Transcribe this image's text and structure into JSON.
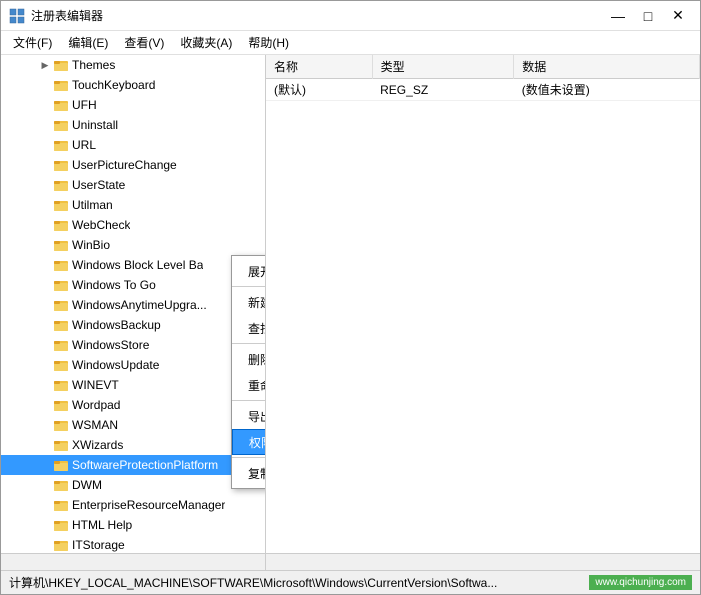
{
  "window": {
    "title": "注册表编辑器",
    "icon": "regedit"
  },
  "titlebar": {
    "controls": {
      "minimize": "—",
      "maximize": "□",
      "close": "✕"
    }
  },
  "menubar": {
    "items": [
      {
        "label": "文件(F)"
      },
      {
        "label": "编辑(E)"
      },
      {
        "label": "查看(V)"
      },
      {
        "label": "收藏夹(A)"
      },
      {
        "label": "帮助(H)"
      }
    ]
  },
  "tree": {
    "items": [
      {
        "label": "Themes",
        "indent": 2,
        "has_arrow": true,
        "level": 2
      },
      {
        "label": "TouchKeyboard",
        "indent": 2,
        "has_arrow": false,
        "level": 2
      },
      {
        "label": "UFH",
        "indent": 2,
        "has_arrow": false,
        "level": 2
      },
      {
        "label": "Uninstall",
        "indent": 2,
        "has_arrow": false,
        "level": 2
      },
      {
        "label": "URL",
        "indent": 2,
        "has_arrow": false,
        "level": 2
      },
      {
        "label": "UserPictureChange",
        "indent": 2,
        "has_arrow": false,
        "level": 2
      },
      {
        "label": "UserState",
        "indent": 2,
        "has_arrow": false,
        "level": 2
      },
      {
        "label": "Utilman",
        "indent": 2,
        "has_arrow": false,
        "level": 2
      },
      {
        "label": "WebCheck",
        "indent": 2,
        "has_arrow": false,
        "level": 2
      },
      {
        "label": "WinBio",
        "indent": 2,
        "has_arrow": false,
        "level": 2
      },
      {
        "label": "Windows Block Level Ba",
        "indent": 2,
        "has_arrow": false,
        "level": 2
      },
      {
        "label": "Windows To Go",
        "indent": 2,
        "has_arrow": false,
        "level": 2
      },
      {
        "label": "WindowsAnytimeUpgra...",
        "indent": 2,
        "has_arrow": false,
        "level": 2
      },
      {
        "label": "WindowsBackup",
        "indent": 2,
        "has_arrow": false,
        "level": 2
      },
      {
        "label": "WindowsStore",
        "indent": 2,
        "has_arrow": false,
        "level": 2
      },
      {
        "label": "WindowsUpdate",
        "indent": 2,
        "has_arrow": false,
        "level": 2
      },
      {
        "label": "WINEVT",
        "indent": 2,
        "has_arrow": false,
        "level": 2
      },
      {
        "label": "Wordpad",
        "indent": 2,
        "has_arrow": false,
        "level": 2
      },
      {
        "label": "WSMAN",
        "indent": 2,
        "has_arrow": false,
        "level": 2
      },
      {
        "label": "XWizards",
        "indent": 2,
        "has_arrow": false,
        "level": 2
      },
      {
        "label": "SoftwareProtectionPlatform",
        "indent": 2,
        "has_arrow": false,
        "level": 2,
        "selected": true
      },
      {
        "label": "DWM",
        "indent": 1,
        "has_arrow": false,
        "level": 1
      },
      {
        "label": "EnterpriseResourceManager",
        "indent": 1,
        "has_arrow": false,
        "level": 1
      },
      {
        "label": "HTML Help",
        "indent": 1,
        "has_arrow": false,
        "level": 1
      },
      {
        "label": "ITStorage",
        "indent": 1,
        "has_arrow": false,
        "level": 1
      }
    ]
  },
  "right_panel": {
    "columns": [
      "名称",
      "类型",
      "数据"
    ],
    "rows": [
      {
        "name": "(默认)",
        "type": "REG_SZ",
        "data": "(数值未设置)"
      }
    ]
  },
  "context_menu": {
    "items": [
      {
        "label": "展开",
        "type": "item"
      },
      {
        "type": "separator"
      },
      {
        "label": "新建(N)",
        "type": "item",
        "has_arrow": true
      },
      {
        "label": "查找(F)...",
        "type": "item"
      },
      {
        "type": "separator"
      },
      {
        "label": "删除(D)",
        "type": "item"
      },
      {
        "label": "重命名(R)",
        "type": "item"
      },
      {
        "type": "separator"
      },
      {
        "label": "导出(E)",
        "type": "item"
      },
      {
        "label": "权限(P)...",
        "type": "item",
        "highlighted": true
      },
      {
        "type": "separator"
      },
      {
        "label": "复制项名称(C)",
        "type": "item"
      }
    ]
  },
  "statusbar": {
    "path": "计算机\\HKEY_LOCAL_MACHINE\\SOFTWARE\\Microsoft\\Windows\\CurrentVersion\\Softwa...",
    "watermark": "www.qichunjing.com"
  }
}
